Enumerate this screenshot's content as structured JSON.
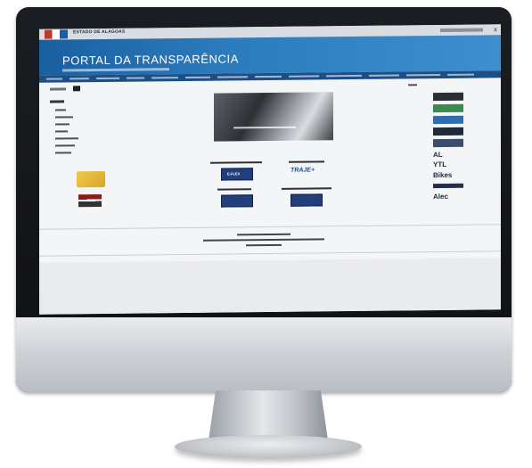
{
  "state_title": "ESTADO DE ALAGOAS",
  "portal_title": "PORTAL DA TRANSPARÊNCIA",
  "close_symbol": "x",
  "badges": {
    "center_left_top": "E-FLEX",
    "center_right_top": "TRAJE+",
    "center_left_bottom": "",
    "center_right_bottom": ""
  },
  "right_sidebar": {
    "logos": [
      "",
      "",
      "",
      "",
      "",
      "AL",
      "YTL",
      "Bikes",
      "",
      "Alec"
    ]
  },
  "colors": {
    "banner": "#2b7bbd",
    "nav": "#1c4f86",
    "bezel": "#0e1014",
    "aluminum": "#cfd3d8"
  }
}
